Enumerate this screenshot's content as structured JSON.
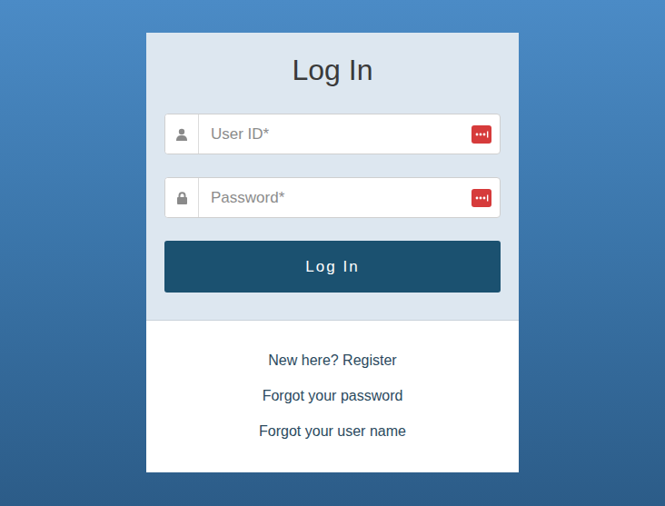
{
  "form": {
    "title": "Log In",
    "fields": [
      {
        "kind": "user",
        "placeholder": "User ID*"
      },
      {
        "kind": "password",
        "placeholder": "Password*"
      }
    ],
    "button": "Log In"
  },
  "links": [
    "New here? Register",
    "Forgot your password",
    "Forgot your user name"
  ]
}
